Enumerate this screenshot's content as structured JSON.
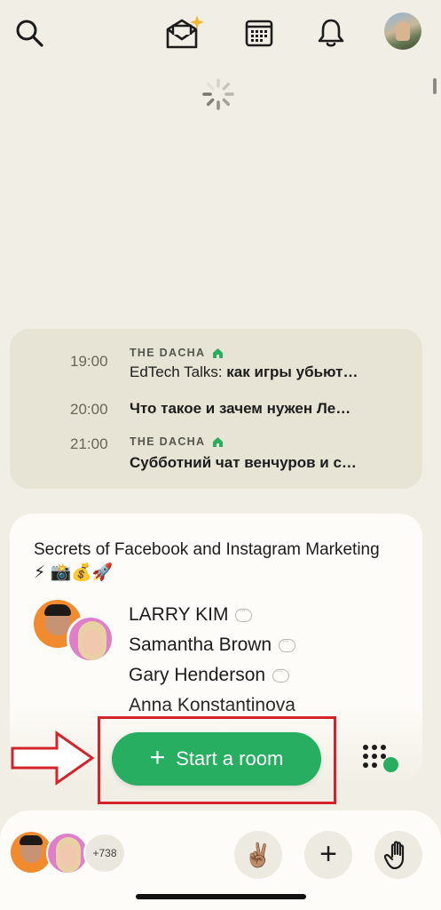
{
  "topbar": {
    "icons": [
      "search-icon",
      "invite-envelope-icon",
      "calendar-icon",
      "bell-icon",
      "profile-avatar"
    ]
  },
  "schedule": {
    "items": [
      {
        "time": "19:00",
        "club": "THE DACHA",
        "title_prefix": "EdTech Talks: ",
        "title_bold": "как игры убьют…"
      },
      {
        "time": "20:00",
        "club": "",
        "title_prefix": "",
        "title_bold": "Что такое и зачем нужен Ле…"
      },
      {
        "time": "21:00",
        "club": "THE DACHA",
        "title_prefix": "",
        "title_bold": "Субботний чат венчуров и с…"
      }
    ]
  },
  "room": {
    "title": "Secrets of Facebook and Instagram Marketing ⚡ 📸💰🚀",
    "speakers": [
      "LARRY KIM",
      "Samantha Brown",
      "Gary Henderson",
      "Anna Konstantinova"
    ]
  },
  "actions": {
    "start_room_label": "Start a room",
    "start_room_plus": "+"
  },
  "bottombar": {
    "online_count": "+738",
    "peace_emoji": "✌🏽",
    "plus_label": "+",
    "hand_icon": "raise-hand-icon"
  },
  "colors": {
    "background": "#f1efe5",
    "accent_green": "#27ae60",
    "highlight_red": "#d4232b"
  }
}
